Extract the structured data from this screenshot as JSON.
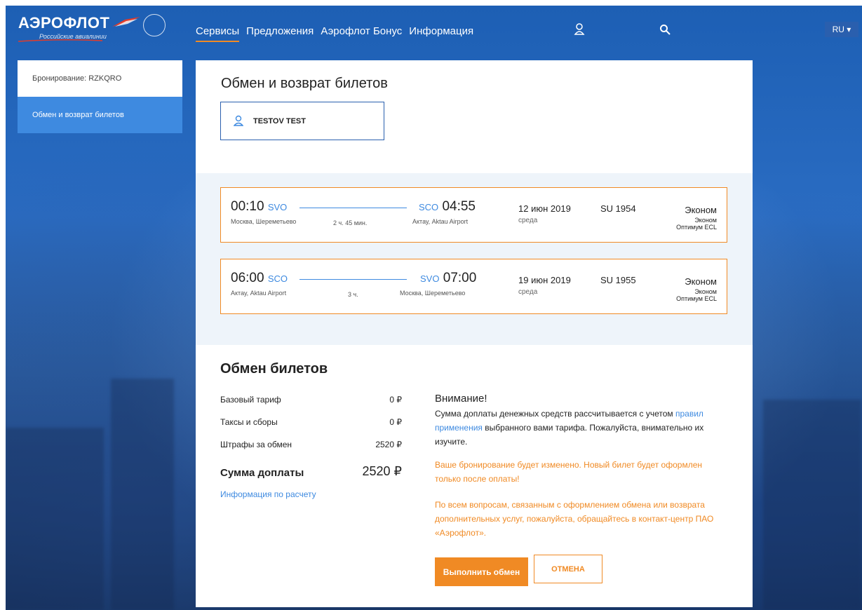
{
  "header": {
    "brand": "АЭРОФЛОТ",
    "tagline": "Российские авиалинии",
    "nav": [
      "Сервисы",
      "Предложения",
      "Аэрофлот Бонус",
      "Информация"
    ],
    "lang": "RU ▾",
    "icons": {
      "user": "user-icon",
      "search": "search-icon"
    }
  },
  "sidebar": {
    "items": [
      {
        "label": "Бронирование: RZKQRO"
      },
      {
        "label": "Обмен и возврат билетов"
      }
    ]
  },
  "page": {
    "title": "Обмен и возврат билетов",
    "passenger": "TESTOV TEST"
  },
  "flights": [
    {
      "dep_time": "00:10",
      "dep_code": "SVO",
      "dep_city": "Москва, Шереметьево",
      "duration": "2 ч. 45 мин.",
      "arr_time": "04:55",
      "arr_code": "SCO",
      "arr_city": "Актау, Aktau Airport",
      "date": "12 июн 2019",
      "dow": "среда",
      "flight_no": "SU 1954",
      "cabin": "Эконом",
      "fare1": "Эконом",
      "fare2": "Оптимум ECL"
    },
    {
      "dep_time": "06:00",
      "dep_code": "SCO",
      "dep_city": "Актау, Aktau Airport",
      "duration": "3 ч.",
      "arr_time": "07:00",
      "arr_code": "SVO",
      "arr_city": "Москва, Шереметьево",
      "date": "19 июн 2019",
      "dow": "среда",
      "flight_no": "SU 1955",
      "cabin": "Эконом",
      "fare1": "Эконом",
      "fare2": "Оптимум ECL"
    }
  ],
  "exchange": {
    "title": "Обмен билетов",
    "fees": [
      {
        "label": "Базовый тариф",
        "value": "0 ₽"
      },
      {
        "label": "Таксы и сборы",
        "value": "0 ₽"
      },
      {
        "label": "Штрафы за обмен",
        "value": "2520 ₽"
      }
    ],
    "total_label": "Сумма доплаты",
    "total_value": "2520 ₽",
    "calc_link": "Информация по расчету",
    "notice_title": "Внимание!",
    "notice_body_1": "Сумма доплаты денежных средств рассчитывается с учетом ",
    "notice_link": "правил применения",
    "notice_body_2": " выбранного вами тарифа. Пожалуйста, внимательно их изучите.",
    "warn_1": "Ваше бронирование будет изменено. Новый билет будет оформлен только после оплаты!",
    "warn_2": "По всем вопросам, связанным с оформлением обмена или возврата дополнительных услуг, пожалуйста, обращайтесь в контакт-центр ПАО «Аэрофлот».",
    "btn_ok": "Выполнить обмен",
    "btn_cancel": "ОТМЕНА"
  },
  "colors": {
    "accent": "#f08a24",
    "link": "#3e8ae0",
    "brand": "#2a5fae"
  }
}
